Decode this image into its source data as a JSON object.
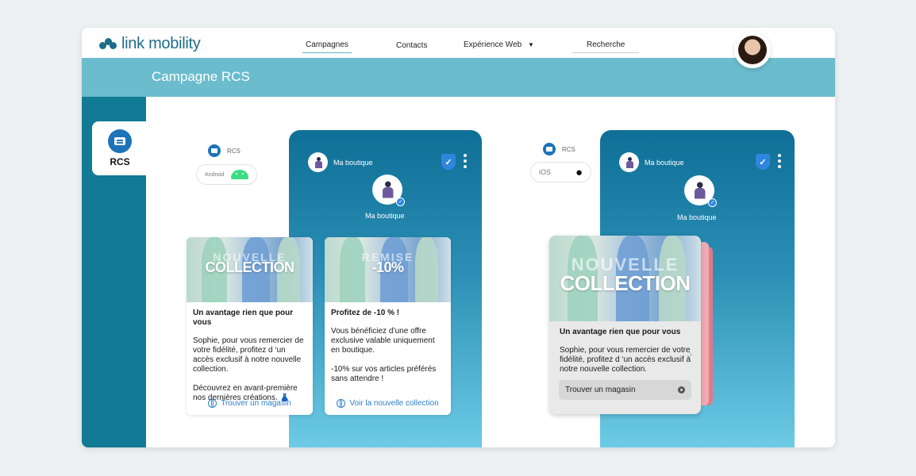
{
  "brand": {
    "logo_text": "link mobility"
  },
  "nav": {
    "campagnes": "Campagnes",
    "contacts": "Contacts",
    "experience_web": "Expérience Web",
    "recherche": "Recherche"
  },
  "header": {
    "title": "Campagne RCS"
  },
  "sidebar": {
    "tab_label": "RCS"
  },
  "android_panel": {
    "channel_label": "RCS",
    "platform_label": "Android",
    "brand_name": "Ma boutique",
    "brand_name_center": "Ma boutique",
    "cards": [
      {
        "image_text": "COLLECTION",
        "image_sub": "NOUVELLE",
        "title": "Un avantage rien que pour vous",
        "text": "Sophie, pour vous remercier de votre fidélité, profitez d ‘un accès exclusif à notre nouvelle collection.\n\nDécouvrez en avant-première nos dernières créations. 👗",
        "link": "Trouver un magasin"
      },
      {
        "image_text": "-10%",
        "image_sub": "REMISE",
        "title": "Profitez de -10 % !",
        "text": "Vous bénéficiez d’une offre exclusive valable uniquement en boutique.\n\n -10% sur vos articles préférés sans attendre !",
        "link": "Voir la nouvelle collection"
      }
    ]
  },
  "ios_panel": {
    "channel_label": "RCS",
    "platform_label": "iOS",
    "brand_name": "Ma boutique",
    "brand_name_center": "Ma boutique",
    "card": {
      "image_text": "COLLECTION",
      "image_sub": "NOUVELLE",
      "title": "Un avantage rien que pour vous",
      "text": "Sophie, pour vous remercier de votre fidélité, profitez d ‘un accès exclusif à notre nouvelle collection.",
      "button": "Trouver un magasin"
    }
  },
  "colors": {
    "sidebar": "#117a94",
    "band": "#6bbccd",
    "link": "#2c7fc9"
  }
}
